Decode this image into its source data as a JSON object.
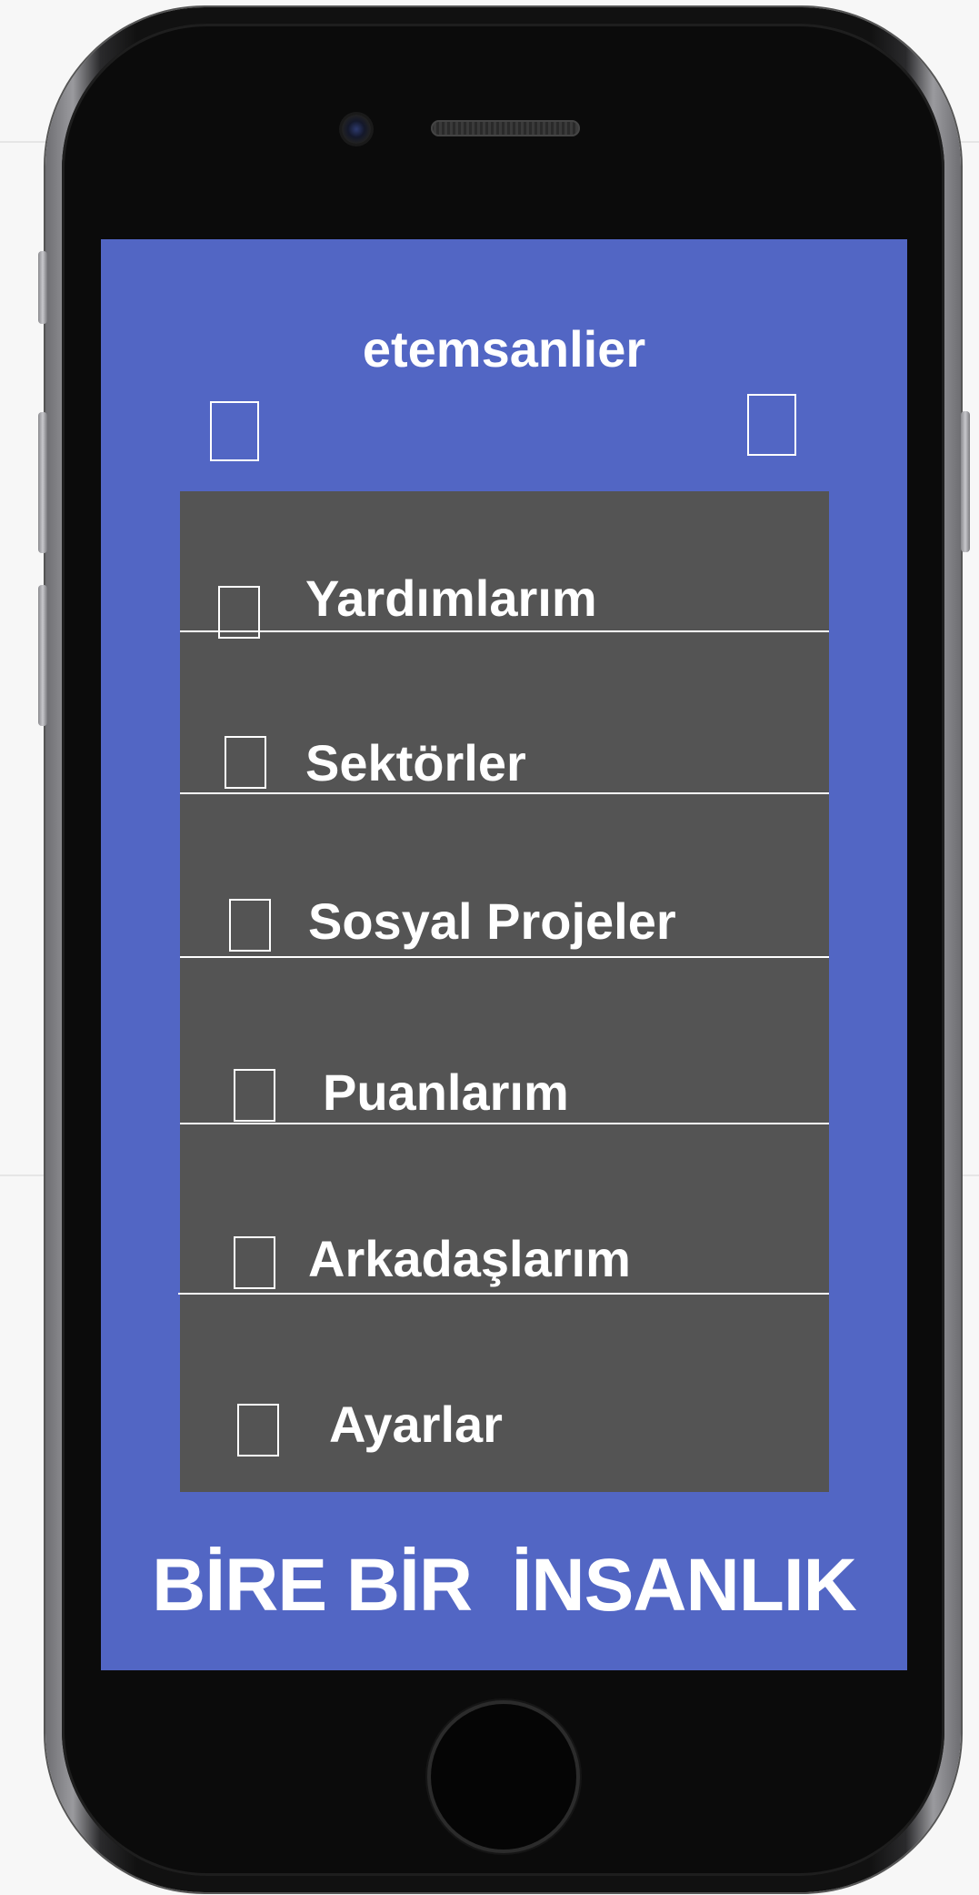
{
  "app": {
    "username": "etemsanlier",
    "slogan": "BİRE BİR  İNSANLIK"
  },
  "header": {
    "left_icon": "menu-icon",
    "right_icon": "profile-icon"
  },
  "menu": {
    "items": [
      {
        "label": "Yardımlarım",
        "icon": "help-icon"
      },
      {
        "label": "Sektörler",
        "icon": "sectors-icon"
      },
      {
        "label": "Sosyal Projeler",
        "icon": "projects-icon"
      },
      {
        "label": "Puanlarım",
        "icon": "points-icon"
      },
      {
        "label": "Arkadaşlarım",
        "icon": "friends-icon"
      },
      {
        "label": "Ayarlar",
        "icon": "settings-icon"
      }
    ]
  },
  "colors": {
    "screen_background": "#5266c4",
    "menu_background": "#545454",
    "text": "#ffffff"
  }
}
